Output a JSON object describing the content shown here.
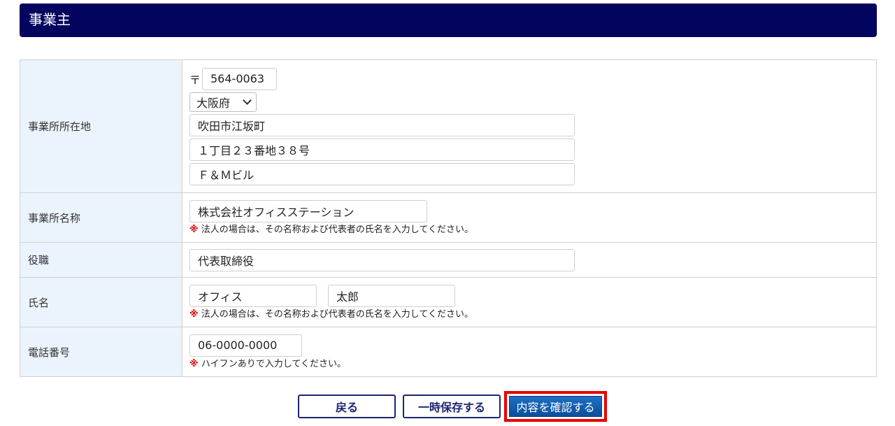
{
  "section": {
    "title": "事業主"
  },
  "fields": {
    "address": {
      "label": "事業所所在地",
      "zip_mark": "〒",
      "zip": "564-0063",
      "prefecture": "大阪府",
      "city": "吹田市江坂町",
      "street": "１丁目２３番地３８号",
      "building": "Ｆ＆Ｍビル"
    },
    "office_name": {
      "label": "事業所名称",
      "value": "株式会社オフィスステーション",
      "note_mark": "※",
      "note": "法人の場合は、その名称および代表者の氏名を入力してください。"
    },
    "position": {
      "label": "役職",
      "value": "代表取締役"
    },
    "person_name": {
      "label": "氏名",
      "last": "オフィス",
      "first": "太郎",
      "note_mark": "※",
      "note": "法人の場合は、その名称および代表者の氏名を入力してください。"
    },
    "phone": {
      "label": "電話番号",
      "value": "06-0000-0000",
      "note_mark": "※",
      "note": "ハイフンありで入力してください。"
    }
  },
  "buttons": {
    "back": "戻る",
    "save_draft": "一時保存する",
    "confirm": "内容を確認する"
  },
  "colors": {
    "header_bg": "#02045e",
    "label_bg": "#ebf4fc",
    "primary": "#1f6fc3",
    "highlight": "#e60000",
    "note_mark": "#e00000"
  }
}
